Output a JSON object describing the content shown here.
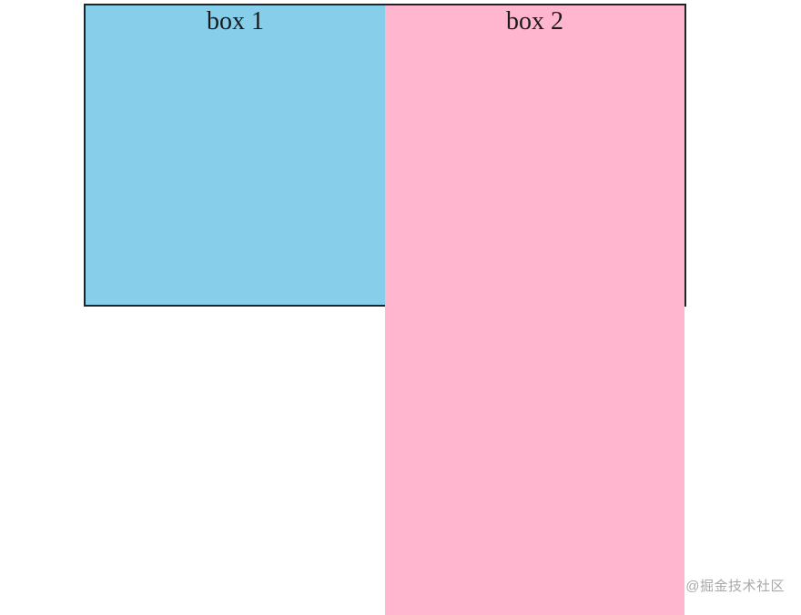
{
  "boxes": {
    "box1_label": "box 1",
    "box2_label": "box 2"
  },
  "colors": {
    "box1_bg": "#87CEEB",
    "box2_bg": "#FFB6CE",
    "border": "#222222"
  },
  "watermark": "@掘金技术社区"
}
